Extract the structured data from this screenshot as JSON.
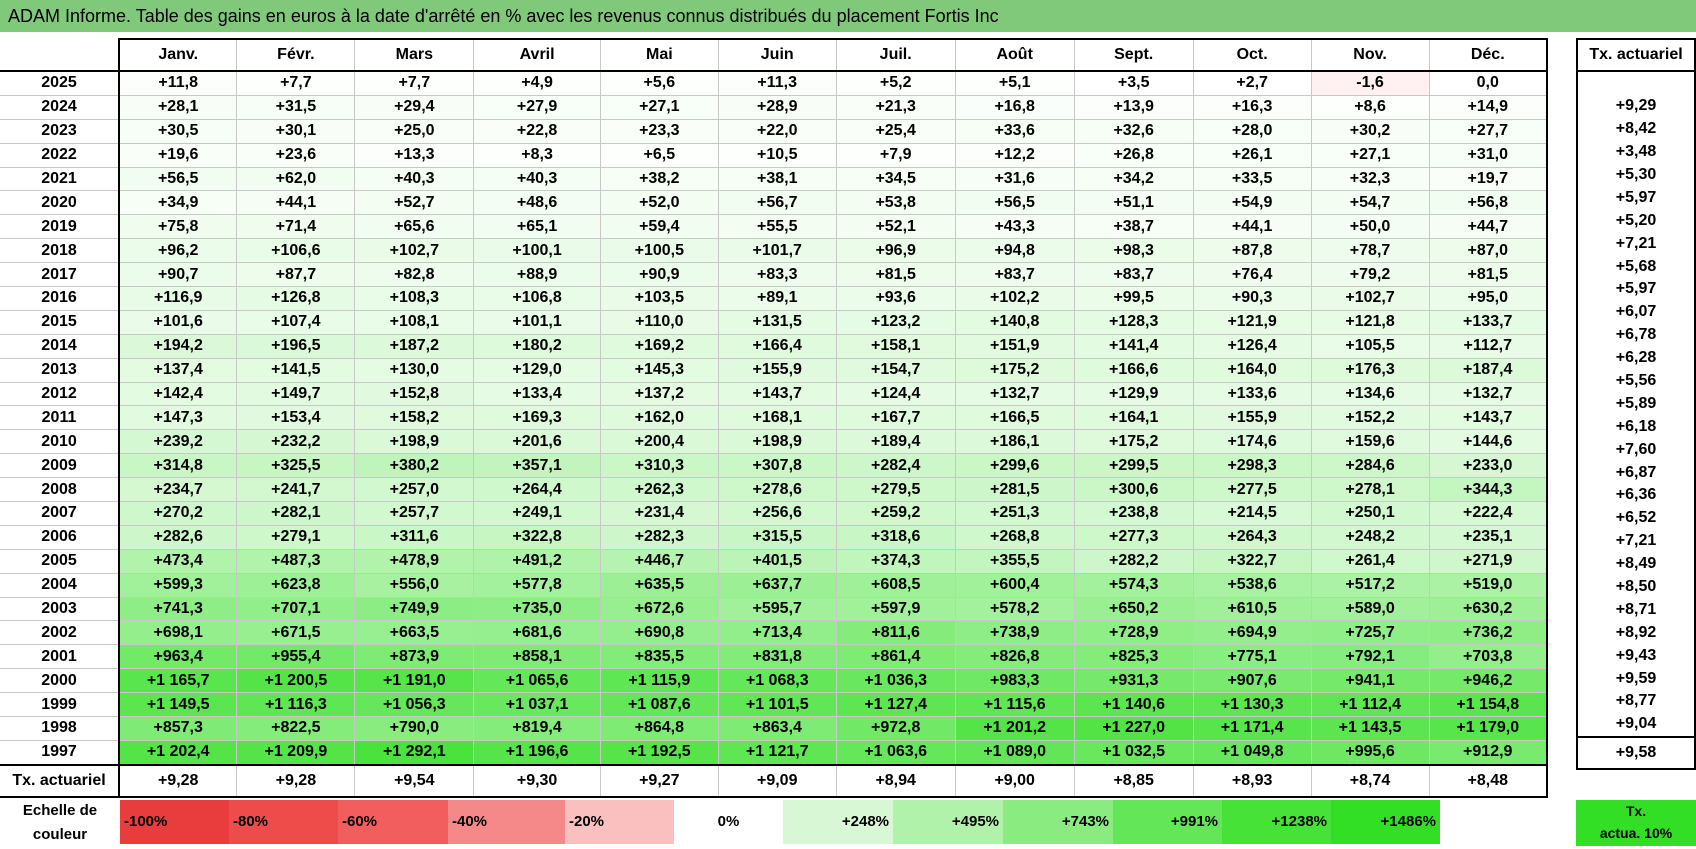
{
  "title": "ADAM Informe. Table des gains en euros à la date d'arrêté en % avec les revenus connus distribués du placement Fortis Inc",
  "months": [
    "Janv.",
    "Févr.",
    "Mars",
    "Avril",
    "Mai",
    "Juin",
    "Juil.",
    "Août",
    "Sept.",
    "Oct.",
    "Nov.",
    "Déc."
  ],
  "side_header": "Tx. actuariel",
  "rows": [
    {
      "year": "2025",
      "values": [
        "+11,8",
        "+7,7",
        "+7,7",
        "+4,9",
        "+5,6",
        "+11,3",
        "+5,2",
        "+5,1",
        "+3,5",
        "+2,7",
        "-1,6",
        "0,0"
      ],
      "rate": ""
    },
    {
      "year": "2024",
      "values": [
        "+28,1",
        "+31,5",
        "+29,4",
        "+27,9",
        "+27,1",
        "+28,9",
        "+21,3",
        "+16,8",
        "+13,9",
        "+16,3",
        "+8,6",
        "+14,9"
      ],
      "rate": "+9,29"
    },
    {
      "year": "2023",
      "values": [
        "+30,5",
        "+30,1",
        "+25,0",
        "+22,8",
        "+23,3",
        "+22,0",
        "+25,4",
        "+33,6",
        "+32,6",
        "+28,0",
        "+30,2",
        "+27,7"
      ],
      "rate": "+8,42"
    },
    {
      "year": "2022",
      "values": [
        "+19,6",
        "+23,6",
        "+13,3",
        "+8,3",
        "+6,5",
        "+10,5",
        "+7,9",
        "+12,2",
        "+26,8",
        "+26,1",
        "+27,1",
        "+31,0"
      ],
      "rate": "+3,48"
    },
    {
      "year": "2021",
      "values": [
        "+56,5",
        "+62,0",
        "+40,3",
        "+40,3",
        "+38,2",
        "+38,1",
        "+34,5",
        "+31,6",
        "+34,2",
        "+33,5",
        "+32,3",
        "+19,7"
      ],
      "rate": "+5,30"
    },
    {
      "year": "2020",
      "values": [
        "+34,9",
        "+44,1",
        "+52,7",
        "+48,6",
        "+52,0",
        "+56,7",
        "+53,8",
        "+56,5",
        "+51,1",
        "+54,9",
        "+54,7",
        "+56,8"
      ],
      "rate": "+5,97"
    },
    {
      "year": "2019",
      "values": [
        "+75,8",
        "+71,4",
        "+65,6",
        "+65,1",
        "+59,4",
        "+55,5",
        "+52,1",
        "+43,3",
        "+38,7",
        "+44,1",
        "+50,0",
        "+44,7"
      ],
      "rate": "+5,20"
    },
    {
      "year": "2018",
      "values": [
        "+96,2",
        "+106,6",
        "+102,7",
        "+100,1",
        "+100,5",
        "+101,7",
        "+96,9",
        "+94,8",
        "+98,3",
        "+87,8",
        "+78,7",
        "+87,0"
      ],
      "rate": "+7,21"
    },
    {
      "year": "2017",
      "values": [
        "+90,7",
        "+87,7",
        "+82,8",
        "+88,9",
        "+90,9",
        "+83,3",
        "+81,5",
        "+83,7",
        "+83,7",
        "+76,4",
        "+79,2",
        "+81,5"
      ],
      "rate": "+5,68"
    },
    {
      "year": "2016",
      "values": [
        "+116,9",
        "+126,8",
        "+108,3",
        "+106,8",
        "+103,5",
        "+89,1",
        "+93,6",
        "+102,2",
        "+99,5",
        "+90,3",
        "+102,7",
        "+95,0"
      ],
      "rate": "+5,97"
    },
    {
      "year": "2015",
      "values": [
        "+101,6",
        "+107,4",
        "+108,1",
        "+101,1",
        "+110,0",
        "+131,5",
        "+123,2",
        "+140,8",
        "+128,3",
        "+121,9",
        "+121,8",
        "+133,7"
      ],
      "rate": "+6,07"
    },
    {
      "year": "2014",
      "values": [
        "+194,2",
        "+196,5",
        "+187,2",
        "+180,2",
        "+169,2",
        "+166,4",
        "+158,1",
        "+151,9",
        "+141,4",
        "+126,4",
        "+105,5",
        "+112,7"
      ],
      "rate": "+6,78"
    },
    {
      "year": "2013",
      "values": [
        "+137,4",
        "+141,5",
        "+130,0",
        "+129,0",
        "+145,3",
        "+155,9",
        "+154,7",
        "+175,2",
        "+166,6",
        "+164,0",
        "+176,3",
        "+187,4"
      ],
      "rate": "+6,28"
    },
    {
      "year": "2012",
      "values": [
        "+142,4",
        "+149,7",
        "+152,8",
        "+133,4",
        "+137,2",
        "+143,7",
        "+124,4",
        "+132,7",
        "+129,9",
        "+133,6",
        "+134,6",
        "+132,7"
      ],
      "rate": "+5,56"
    },
    {
      "year": "2011",
      "values": [
        "+147,3",
        "+153,4",
        "+158,2",
        "+169,3",
        "+162,0",
        "+168,1",
        "+167,7",
        "+166,5",
        "+164,1",
        "+155,9",
        "+152,2",
        "+143,7"
      ],
      "rate": "+5,89"
    },
    {
      "year": "2010",
      "values": [
        "+239,2",
        "+232,2",
        "+198,9",
        "+201,6",
        "+200,4",
        "+198,9",
        "+189,4",
        "+186,1",
        "+175,2",
        "+174,6",
        "+159,6",
        "+144,6"
      ],
      "rate": "+6,18"
    },
    {
      "year": "2009",
      "values": [
        "+314,8",
        "+325,5",
        "+380,2",
        "+357,1",
        "+310,3",
        "+307,8",
        "+282,4",
        "+299,6",
        "+299,5",
        "+298,3",
        "+284,6",
        "+233,0"
      ],
      "rate": "+7,60"
    },
    {
      "year": "2008",
      "values": [
        "+234,7",
        "+241,7",
        "+257,0",
        "+264,4",
        "+262,3",
        "+278,6",
        "+279,5",
        "+281,5",
        "+300,6",
        "+277,5",
        "+278,1",
        "+344,3"
      ],
      "rate": "+6,87"
    },
    {
      "year": "2007",
      "values": [
        "+270,2",
        "+282,1",
        "+257,7",
        "+249,1",
        "+231,4",
        "+256,6",
        "+259,2",
        "+251,3",
        "+238,8",
        "+214,5",
        "+250,1",
        "+222,4"
      ],
      "rate": "+6,36"
    },
    {
      "year": "2006",
      "values": [
        "+282,6",
        "+279,1",
        "+311,6",
        "+322,8",
        "+282,3",
        "+315,5",
        "+318,6",
        "+268,8",
        "+277,3",
        "+264,3",
        "+248,2",
        "+235,1"
      ],
      "rate": "+6,52"
    },
    {
      "year": "2005",
      "values": [
        "+473,4",
        "+487,3",
        "+478,9",
        "+491,2",
        "+446,7",
        "+401,5",
        "+374,3",
        "+355,5",
        "+282,2",
        "+322,7",
        "+261,4",
        "+271,9"
      ],
      "rate": "+7,21"
    },
    {
      "year": "2004",
      "values": [
        "+599,3",
        "+623,8",
        "+556,0",
        "+577,8",
        "+635,5",
        "+637,7",
        "+608,5",
        "+600,4",
        "+574,3",
        "+538,6",
        "+517,2",
        "+519,0"
      ],
      "rate": "+8,49"
    },
    {
      "year": "2003",
      "values": [
        "+741,3",
        "+707,1",
        "+749,9",
        "+735,0",
        "+672,6",
        "+595,7",
        "+597,9",
        "+578,2",
        "+650,2",
        "+610,5",
        "+589,0",
        "+630,2"
      ],
      "rate": "+8,50"
    },
    {
      "year": "2002",
      "values": [
        "+698,1",
        "+671,5",
        "+663,5",
        "+681,6",
        "+690,8",
        "+713,4",
        "+811,6",
        "+738,9",
        "+728,9",
        "+694,9",
        "+725,7",
        "+736,2"
      ],
      "rate": "+8,71"
    },
    {
      "year": "2001",
      "values": [
        "+963,4",
        "+955,4",
        "+873,9",
        "+858,1",
        "+835,5",
        "+831,8",
        "+861,4",
        "+826,8",
        "+825,3",
        "+775,1",
        "+792,1",
        "+703,8"
      ],
      "rate": "+8,92"
    },
    {
      "year": "2000",
      "values": [
        "+1 165,7",
        "+1 200,5",
        "+1 191,0",
        "+1 065,6",
        "+1 115,9",
        "+1 068,3",
        "+1 036,3",
        "+983,3",
        "+931,3",
        "+907,6",
        "+941,1",
        "+946,2"
      ],
      "rate": "+9,43"
    },
    {
      "year": "1999",
      "values": [
        "+1 149,5",
        "+1 116,3",
        "+1 056,3",
        "+1 037,1",
        "+1 087,6",
        "+1 101,5",
        "+1 127,4",
        "+1 115,6",
        "+1 140,6",
        "+1 130,3",
        "+1 112,4",
        "+1 154,8"
      ],
      "rate": "+9,59"
    },
    {
      "year": "1998",
      "values": [
        "+857,3",
        "+822,5",
        "+790,0",
        "+819,4",
        "+864,8",
        "+863,4",
        "+972,8",
        "+1 201,2",
        "+1 227,0",
        "+1 171,4",
        "+1 143,5",
        "+1 179,0"
      ],
      "rate": "+8,77"
    },
    {
      "year": "1997",
      "values": [
        "+1 202,4",
        "+1 209,9",
        "+1 292,1",
        "+1 196,6",
        "+1 192,5",
        "+1 121,7",
        "+1 063,6",
        "+1 089,0",
        "+1 032,5",
        "+1 049,8",
        "+995,6",
        "+912,9"
      ],
      "rate": "+9,04"
    }
  ],
  "totals": {
    "label": "Tx. actuariel",
    "values": [
      "+9,28",
      "+9,28",
      "+9,54",
      "+9,30",
      "+9,27",
      "+9,09",
      "+8,94",
      "+9,00",
      "+8,85",
      "+8,93",
      "+8,74",
      "+8,48"
    ],
    "overall": "+9,58"
  },
  "scale": {
    "label_line1": "Echelle de",
    "label_line2": "couleur",
    "items": [
      {
        "label": "-100%",
        "color": "#e93c3c"
      },
      {
        "label": "-80%",
        "color": "#ee4b4b"
      },
      {
        "label": "-60%",
        "color": "#f25d5d"
      },
      {
        "label": "-40%",
        "color": "#f58888"
      },
      {
        "label": "-20%",
        "color": "#fac0c0"
      },
      {
        "label": "0%",
        "color": "#ffffff"
      },
      {
        "label": "+248%",
        "color": "#d8f8d5"
      },
      {
        "label": "+495%",
        "color": "#b1f2aa"
      },
      {
        "label": "+743%",
        "color": "#8aec80"
      },
      {
        "label": "+991%",
        "color": "#63e657"
      },
      {
        "label": "+1238%",
        "color": "#46e238"
      },
      {
        "label": "+1486%",
        "color": "#33df24"
      }
    ],
    "side_line1": "Tx.",
    "side_line2": "actua. 10%",
    "side_color": "#33df24"
  }
}
